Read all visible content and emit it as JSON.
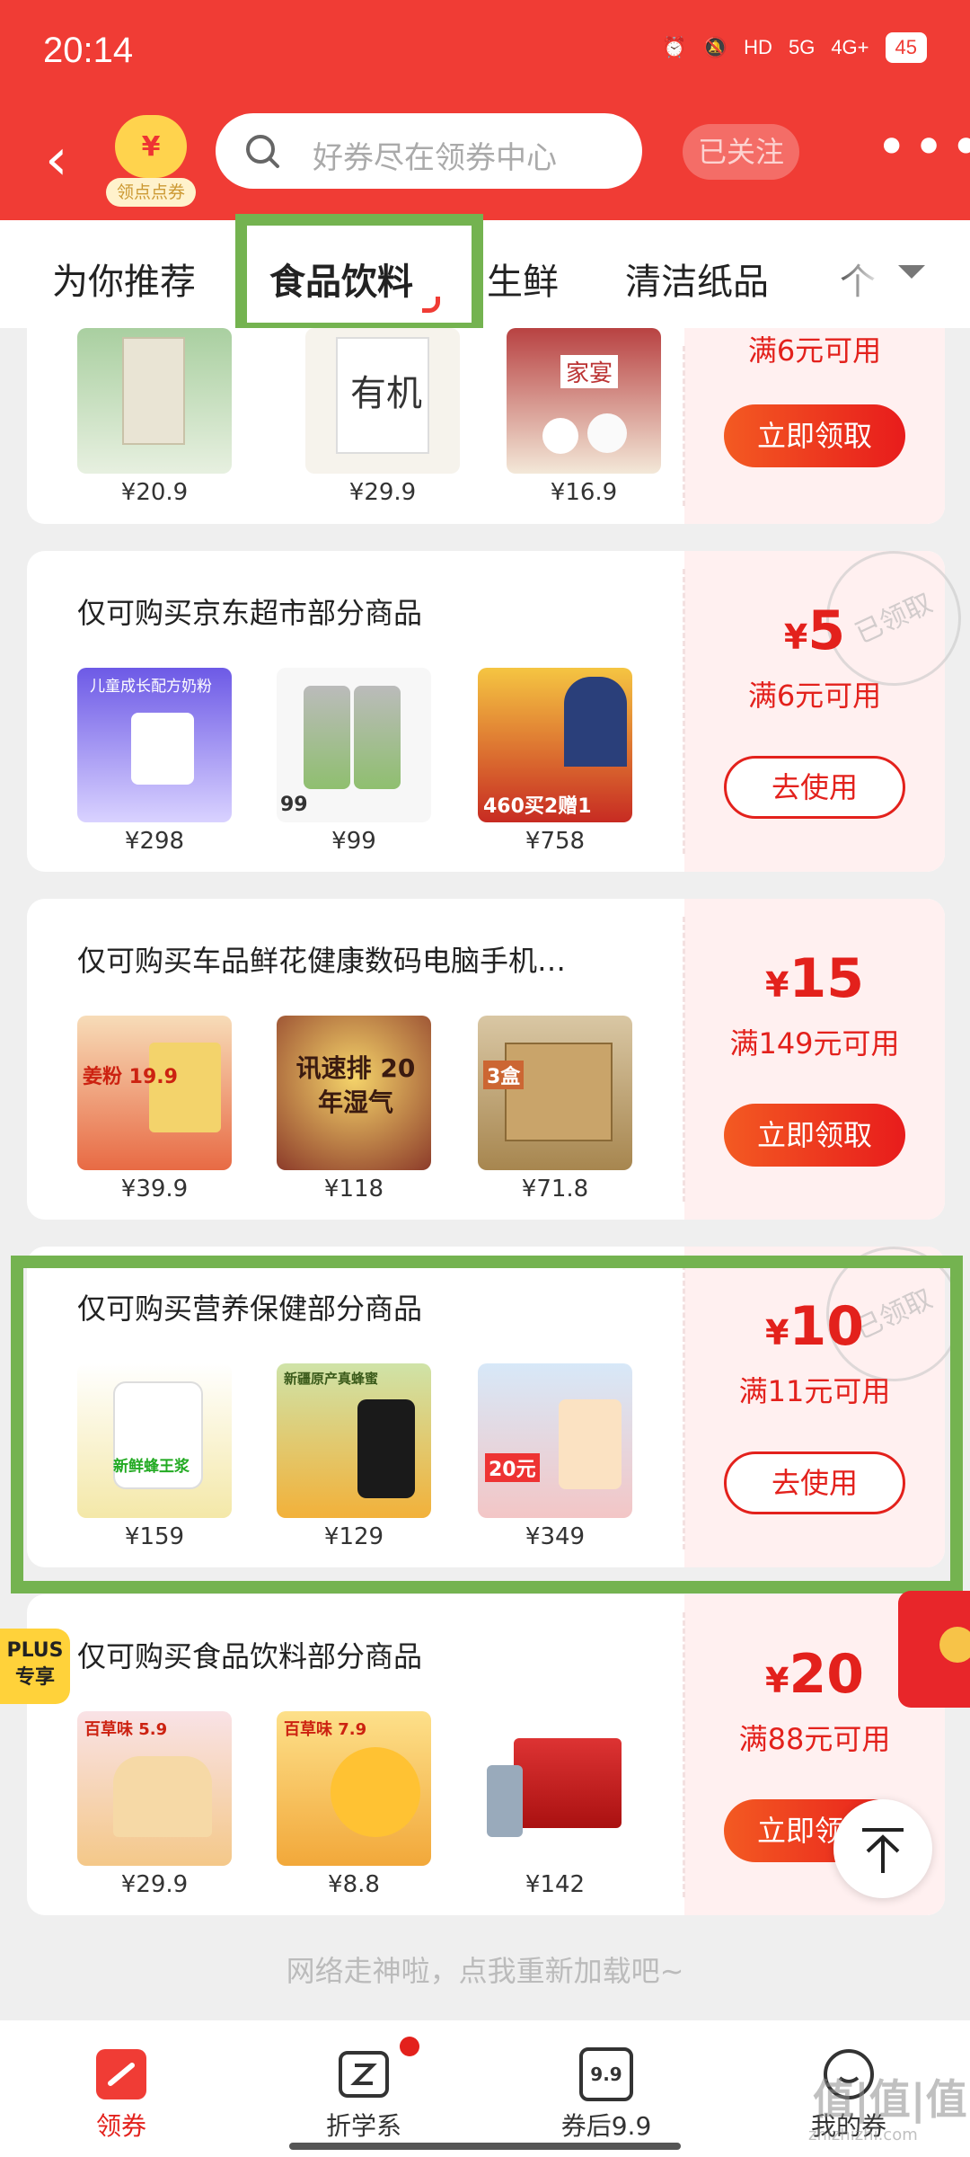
{
  "status_bar": {
    "time": "20:14",
    "battery": "45",
    "net1": "5G",
    "net2": "4G+",
    "hd": "HD"
  },
  "nav": {
    "badge_label": "领点点券",
    "badge_symbol": "¥",
    "search_placeholder": "好券尽在领券中心",
    "follow_label": "已关注",
    "more_label": "•••"
  },
  "tabs": [
    "为你推荐",
    "食品饮料",
    "生鲜",
    "清洁纸品",
    "个"
  ],
  "active_tab": 1,
  "cards": [
    {
      "title": "",
      "products": [
        {
          "price": "¥20.9",
          "img": "tea-package"
        },
        {
          "price": "¥29.9",
          "img": "flour-bag",
          "img_text": "有机"
        },
        {
          "price": "¥16.9",
          "img": "buns",
          "img_text": "家宴"
        }
      ],
      "condition": "满6元可用",
      "button": "立即领取"
    },
    {
      "title": "仅可购买京东超市部分商品",
      "products": [
        {
          "price": "¥298",
          "img": "milk-powder",
          "img_text": "儿童成长配方奶粉"
        },
        {
          "price": "¥99",
          "img": "tea-cans",
          "img_text": "99"
        },
        {
          "price": "¥758",
          "img": "wine-box",
          "img_text": "460买2赠1"
        }
      ],
      "amount": "5",
      "condition": "满6元可用",
      "button": "去使用",
      "stamp": "已领取"
    },
    {
      "title": "仅可购买车品鲜花健康数码电脑手机…",
      "products": [
        {
          "price": "¥39.9",
          "img": "ginger-powder",
          "img_text": "姜粉 19.9"
        },
        {
          "price": "¥118",
          "img": "herbal-tea",
          "img_text": "讯速排 20年湿气"
        },
        {
          "price": "¥71.8",
          "img": "herbal-box",
          "img_text": "3盒"
        }
      ],
      "amount": "15",
      "condition": "满149元可用",
      "button": "立即领取"
    },
    {
      "title": "仅可购买营养保健部分商品",
      "products": [
        {
          "price": "¥159",
          "img": "royal-jelly",
          "img_text": "新鲜蜂王浆"
        },
        {
          "price": "¥129",
          "img": "honey",
          "img_text": "新疆原产真蜂蜜"
        },
        {
          "price": "¥349",
          "img": "protein-powder",
          "img_text": "20元"
        }
      ],
      "amount": "10",
      "condition": "满11元可用",
      "button": "去使用",
      "stamp": "已领取"
    },
    {
      "title": "仅可购买食品饮料部分商品",
      "plus_badge": "PLUS专享",
      "products": [
        {
          "price": "¥29.9",
          "img": "toast-bread",
          "img_text": "百草味 5.9"
        },
        {
          "price": "¥8.8",
          "img": "dried-mango",
          "img_text": "百草味 7.9"
        },
        {
          "price": "¥142",
          "img": "gift-box"
        }
      ],
      "amount": "20",
      "condition": "满88元可用",
      "button": "立即领取"
    }
  ],
  "yen_symbol": "¥",
  "reload_text": "网络走神啦，点我重新加载吧~",
  "bottom_nav": [
    {
      "label": "领券",
      "icon": "coupon-icon"
    },
    {
      "label": "折学系",
      "icon": "z-icon"
    },
    {
      "label": "券后9.9",
      "icon": "nine-nine-icon",
      "icon_text": "9.9"
    },
    {
      "label": "我的券",
      "icon": "my-coupon-icon"
    }
  ],
  "watermark": "值|值|值",
  "watermark_url": "zhizhizhi.com"
}
